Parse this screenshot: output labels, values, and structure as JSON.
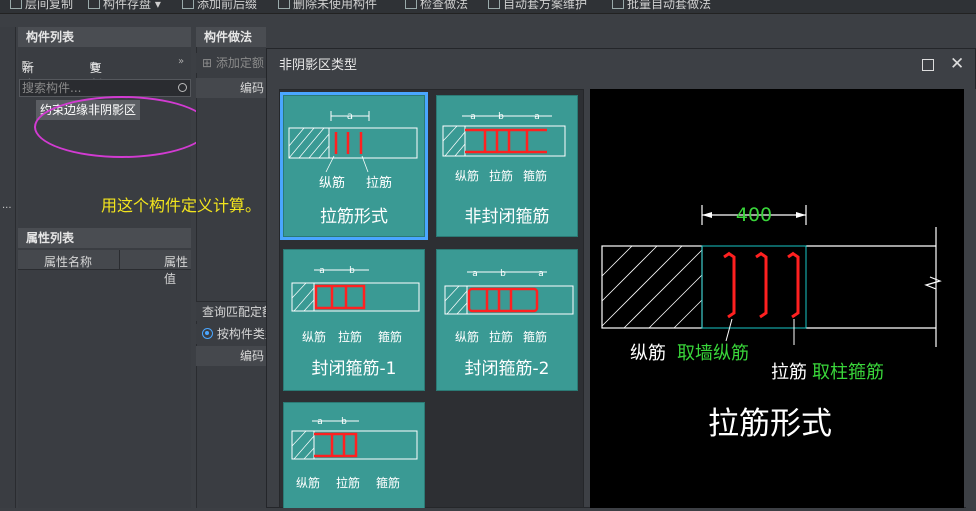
{
  "toolbar": {
    "items": [
      "层间复制",
      "构件存盘",
      "添加前后缀",
      "删除未使用构件",
      "检查做法",
      "自动套方案维护",
      "批量自动套做法"
    ]
  },
  "left_panel": {
    "title": "构件列表",
    "new_label": "新建",
    "copy_label": "复制",
    "search_placeholder": "搜索构件...",
    "tree_item": "约束边缘非阴影区"
  },
  "annotation": {
    "note": "用这个构件定义计算。"
  },
  "property_panel": {
    "title": "属性列表",
    "col_name": "属性名称",
    "col_value": "属性值"
  },
  "method_panel": {
    "title": "构件做法",
    "add_label": "添加定额",
    "code_label": "编码",
    "query_label": "查询匹配定额",
    "radio_label": "按构件类型",
    "code_label2": "编码"
  },
  "dialog": {
    "title": "非阴影区类型",
    "cards": [
      {
        "caption": "拉筋形式",
        "selected": true,
        "labels": [
          "纵筋",
          "拉筋"
        ],
        "dims": [
          "a"
        ]
      },
      {
        "caption": "非封闭箍筋",
        "selected": false,
        "labels": [
          "纵筋",
          "拉筋",
          "箍筋"
        ],
        "dims": [
          "a",
          "b",
          "a"
        ]
      },
      {
        "caption": "封闭箍筋-1",
        "selected": false,
        "labels": [
          "纵筋",
          "拉筋",
          "箍筋"
        ],
        "dims": [
          "a",
          "b"
        ]
      },
      {
        "caption": "封闭箍筋-2",
        "selected": false,
        "labels": [
          "纵筋",
          "拉筋",
          "箍筋"
        ],
        "dims": [
          "a",
          "b",
          "a"
        ]
      },
      {
        "caption": "",
        "selected": false,
        "labels": [
          "纵筋",
          "拉筋",
          "箍筋"
        ],
        "dims": [
          "a",
          "b"
        ]
      }
    ],
    "preview": {
      "dim_value": "400",
      "label_zongjin": "纵筋",
      "label_zongjin_rule": "取墙纵筋",
      "label_lajin": "拉筋",
      "label_lajin_rule": "取柱箍筋",
      "caption": "拉筋形式"
    }
  },
  "colors": {
    "card_bg": "#3a9a94",
    "selection": "#4aa6ff",
    "rebar": "#ff2020",
    "dim_green": "#39d53a",
    "note_yellow": "#f2e41d",
    "callout": "#d23bd2"
  }
}
